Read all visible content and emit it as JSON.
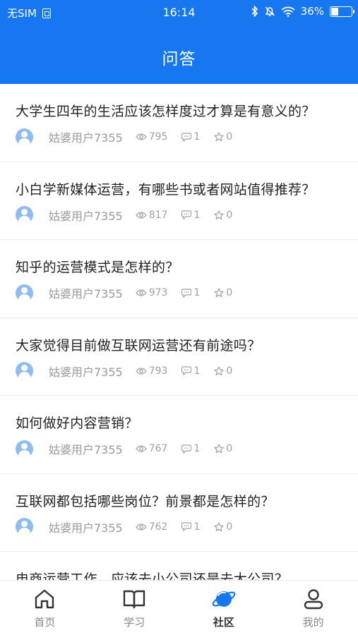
{
  "status_bar": {
    "carrier": "无SIM",
    "time": "16:14",
    "battery": "36%",
    "battery_level": 0.36
  },
  "nav": {
    "title": "问答"
  },
  "questions": [
    {
      "title": "大学生四年的生活应该怎样度过才算是有意义的？",
      "user": "姑婆用户7355",
      "views": "795",
      "comments": "1",
      "stars": "0"
    },
    {
      "title": "小白学新媒体运营，有哪些书或者网站值得推荐？",
      "user": "姑婆用户7355",
      "views": "817",
      "comments": "1",
      "stars": "0"
    },
    {
      "title": "知乎的运营模式是怎样的？",
      "user": "姑婆用户7355",
      "views": "973",
      "comments": "1",
      "stars": "0"
    },
    {
      "title": "大家觉得目前做互联网运营还有前途吗？",
      "user": "姑婆用户7355",
      "views": "793",
      "comments": "1",
      "stars": "0"
    },
    {
      "title": "如何做好内容营销？",
      "user": "姑婆用户7355",
      "views": "767",
      "comments": "1",
      "stars": "0"
    },
    {
      "title": "互联网都包括哪些岗位？前景都是怎样的？",
      "user": "姑婆用户7355",
      "views": "762",
      "comments": "1",
      "stars": "0"
    },
    {
      "title": "电商运营工作，应该去小公司还是去大公司？",
      "user": "",
      "views": "",
      "comments": "",
      "stars": ""
    }
  ],
  "tabbar": {
    "items": [
      {
        "label": "首页",
        "icon": "home-icon",
        "active": false
      },
      {
        "label": "学习",
        "icon": "book-icon",
        "active": false
      },
      {
        "label": "社区",
        "icon": "planet-icon",
        "active": true
      },
      {
        "label": "我的",
        "icon": "user-icon",
        "active": false
      }
    ]
  },
  "colors": {
    "brand": "#1677f0",
    "avatar": "#8fbdf2",
    "muted_text": "#9a9a9a"
  }
}
